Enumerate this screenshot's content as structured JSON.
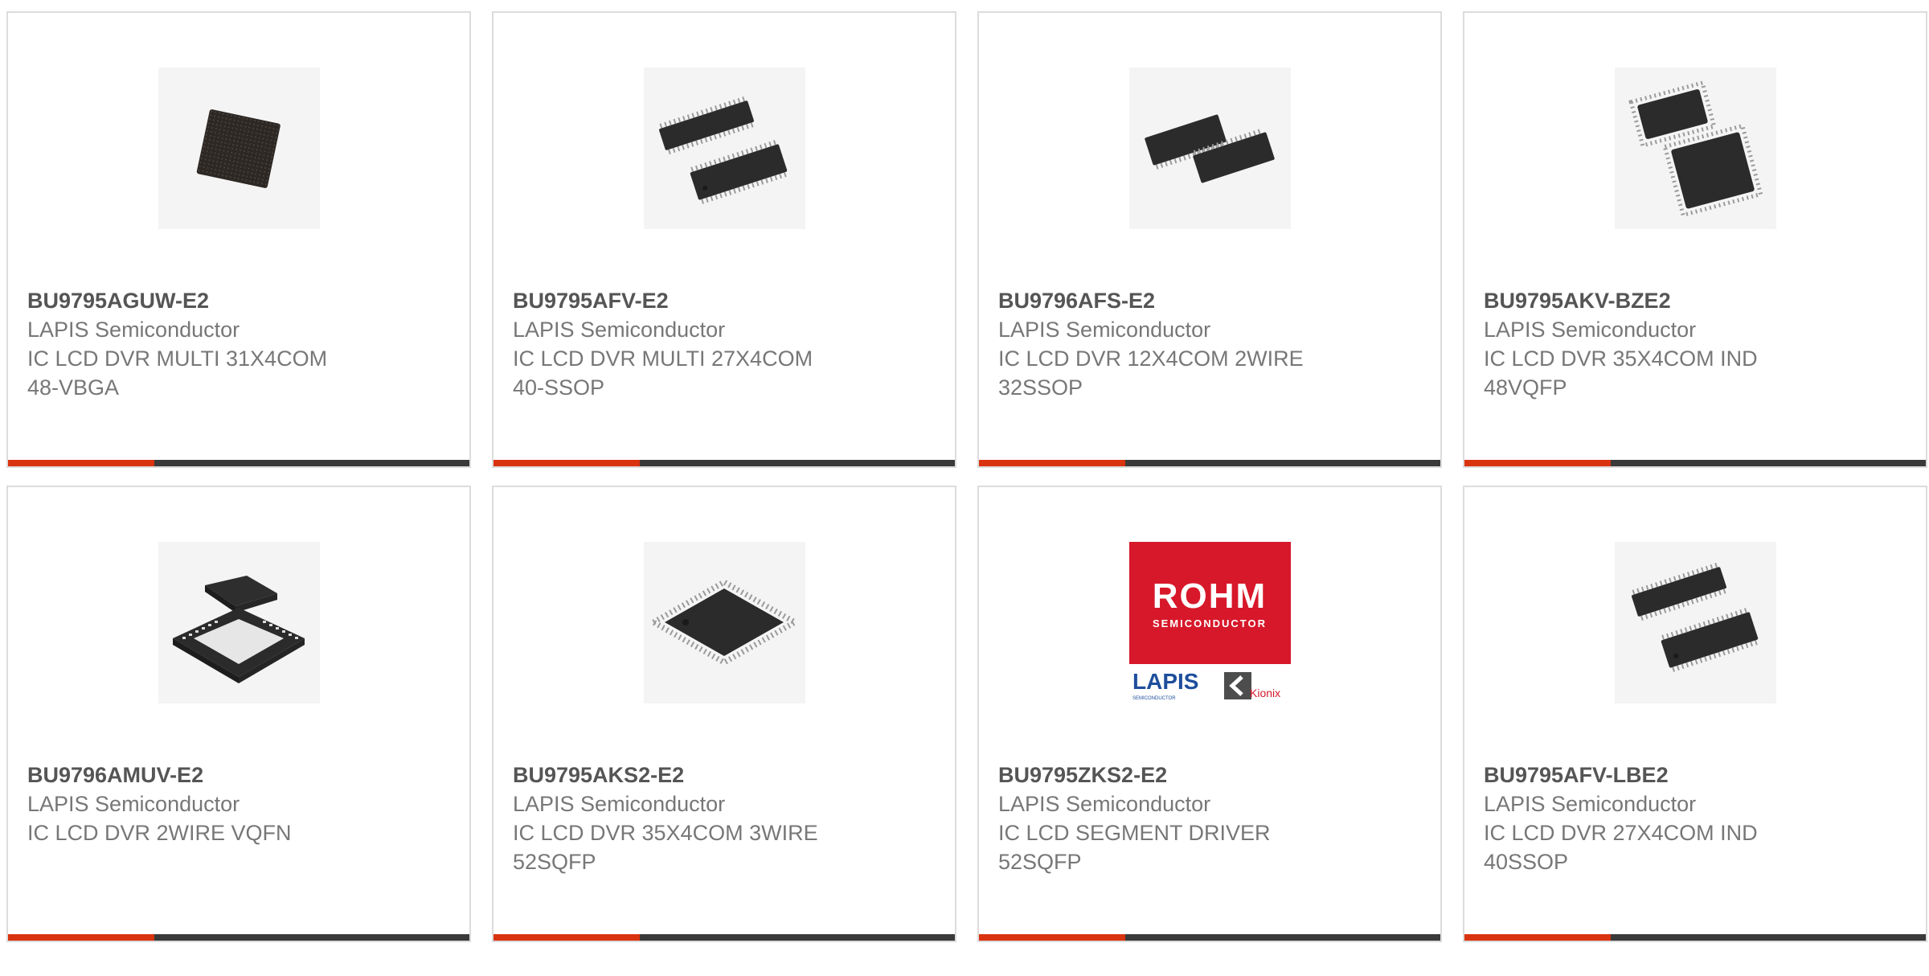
{
  "products": [
    {
      "part": "BU9795AGUW-E2",
      "maker": "LAPIS Semiconductor",
      "desc1": "IC LCD DVR MULTI 31X4COM",
      "desc2": "48-VBGA",
      "image": "bga-chip-icon"
    },
    {
      "part": "BU9795AFV-E2",
      "maker": "LAPIS Semiconductor",
      "desc1": "IC LCD DVR MULTI 27X4COM",
      "desc2": "40-SSOP",
      "image": "ssop-chip-icon"
    },
    {
      "part": "BU9796AFS-E2",
      "maker": "LAPIS Semiconductor",
      "desc1": "IC LCD DVR 12X4COM 2WIRE",
      "desc2": "32SSOP",
      "image": "ssop-chip-icon"
    },
    {
      "part": "BU9795AKV-BZE2",
      "maker": "LAPIS Semiconductor",
      "desc1": "IC LCD DVR 35X4COM IND",
      "desc2": "48VQFP",
      "image": "qfp-chip-icon"
    },
    {
      "part": "BU9796AMUV-E2",
      "maker": "LAPIS Semiconductor",
      "desc1": "IC LCD DVR 2WIRE VQFN",
      "desc2": "",
      "image": "qfn-chip-icon"
    },
    {
      "part": "BU9795AKS2-E2",
      "maker": "LAPIS Semiconductor",
      "desc1": "IC LCD DVR 35X4COM 3WIRE",
      "desc2": "52SQFP",
      "image": "sqfp-chip-icon"
    },
    {
      "part": "BU9795ZKS2-E2",
      "maker": "LAPIS Semiconductor",
      "desc1": "IC LCD SEGMENT DRIVER",
      "desc2": "52SQFP",
      "image": "rohm-logo",
      "logo": {
        "brand": "ROHM",
        "sub": "SEMICONDUCTOR",
        "lapis": "LAPIS",
        "lapis_sub": "SEMICONDUCTOR",
        "kionix": "Kionix"
      }
    },
    {
      "part": "BU9795AFV-LBE2",
      "maker": "LAPIS Semiconductor",
      "desc1": "IC LCD DVR 27X4COM IND",
      "desc2": "40SSOP",
      "image": "ssop-chip-icon"
    }
  ],
  "colors": {
    "accent": "#d9330f",
    "bar": "#3a3a3a",
    "border": "#dcdcdc",
    "text": "#777777",
    "brand_red": "#d7182a"
  }
}
